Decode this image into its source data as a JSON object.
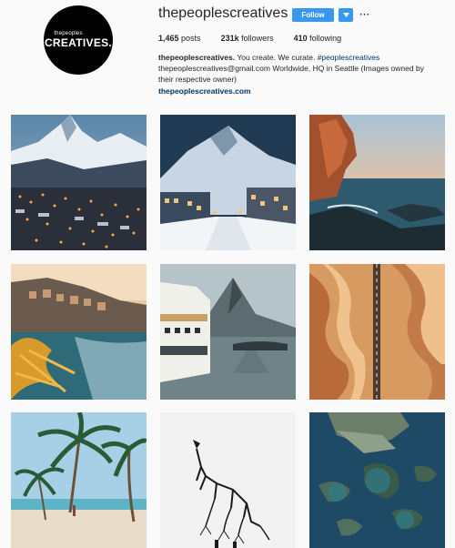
{
  "profile": {
    "avatar_small": "thepeoples",
    "avatar_big": "CREATIVES.",
    "username": "thepeoplescreatives",
    "follow_label": "Follow",
    "more_label": "···",
    "stats": {
      "posts_count": "1,465",
      "posts_label": "posts",
      "followers_count": "231k",
      "followers_label": "followers",
      "following_count": "410",
      "following_label": "following"
    },
    "bio": {
      "name": "thepeoplescreatives.",
      "text1": "You create. We curate.",
      "hashtag": "#peoplescreatives",
      "text2": "thepeoplescreatives@gmail.com Worldwide, HQ in Seattle (Images owned by their respective owner)",
      "link": "thepeoplescreatives.com"
    }
  },
  "colors": {
    "accent": "#3897f0",
    "link": "#003569",
    "background": "#fafafa"
  },
  "posts": [
    {
      "subject": "snowy-mountain-village-night"
    },
    {
      "subject": "snowy-town-street-mountain"
    },
    {
      "subject": "sea-cliff-sunset"
    },
    {
      "subject": "cliffside-village-sea"
    },
    {
      "subject": "ferry-mountain-fjord"
    },
    {
      "subject": "desert-dunes-road-aerial"
    },
    {
      "subject": "palm-beach"
    },
    {
      "subject": "wolf-trees-illustration"
    },
    {
      "subject": "islands-aerial"
    }
  ]
}
